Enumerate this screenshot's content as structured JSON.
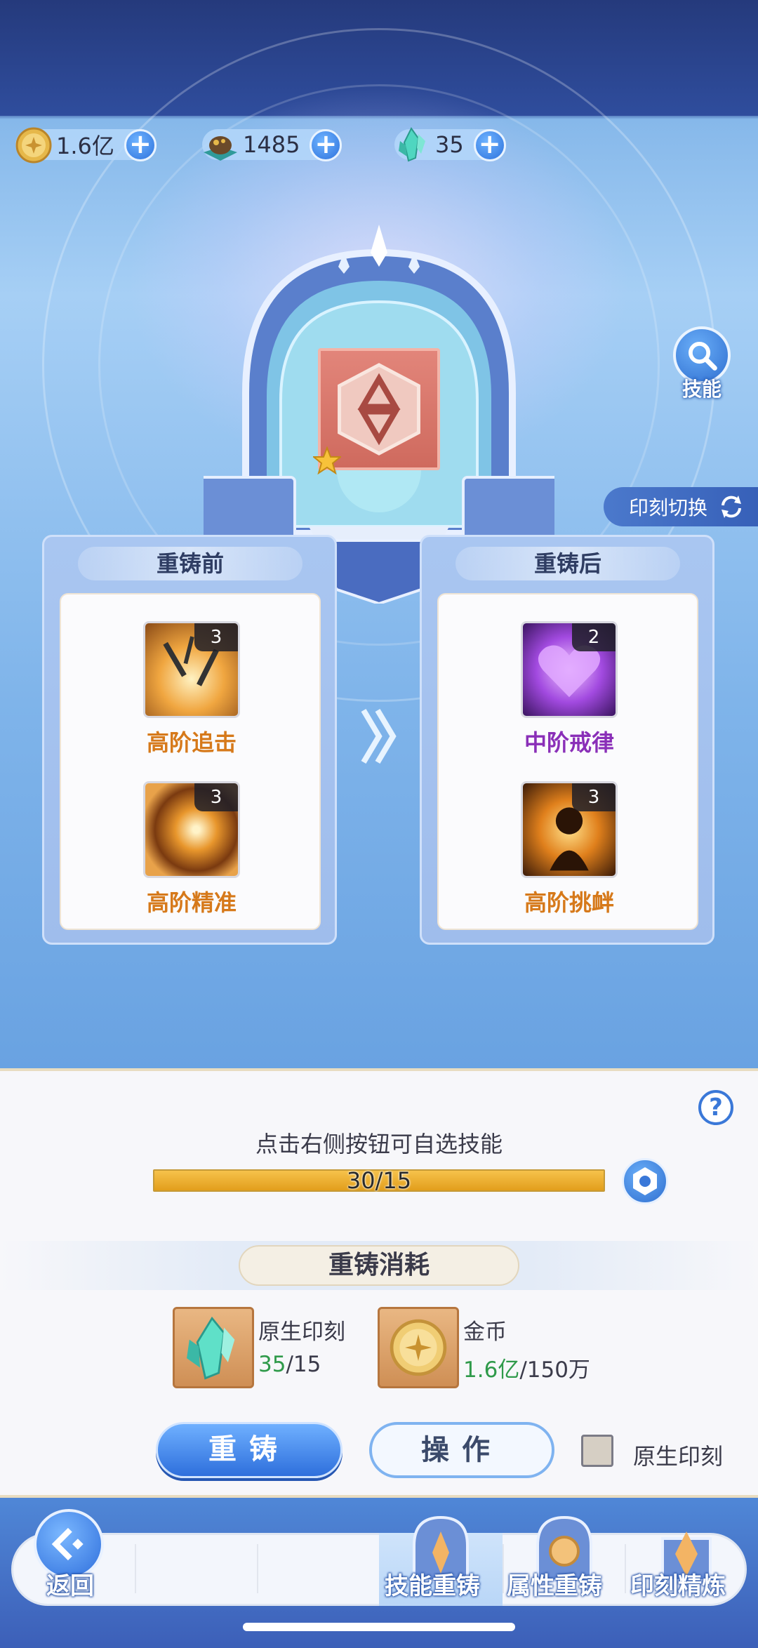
{
  "currencies": [
    {
      "icon": "gold-coin-icon",
      "value": "1.6亿"
    },
    {
      "icon": "ore-pile-icon",
      "value": "1485"
    },
    {
      "icon": "crystal-icon",
      "value": "35"
    }
  ],
  "side": {
    "skill_label": "技能",
    "switch_label": "印刻切换"
  },
  "before": {
    "title": "重铸前",
    "skills": [
      {
        "name": "高阶追击",
        "level": "3",
        "icon": "daggers-icon"
      },
      {
        "name": "高阶精准",
        "level": "3",
        "icon": "vortex-icon"
      }
    ]
  },
  "after": {
    "title": "重铸后",
    "skills": [
      {
        "name": "中阶戒律",
        "level": "2",
        "icon": "heart-icon"
      },
      {
        "name": "高阶挑衅",
        "level": "3",
        "icon": "taunt-figure-icon"
      }
    ]
  },
  "bottom": {
    "hint": "点击右侧按钮可自选技能",
    "progress": {
      "text": "30/15",
      "current": 30,
      "max": 15
    },
    "cost_title": "重铸消耗",
    "costs": [
      {
        "name": "原生印刻",
        "have": "35",
        "need": "/15",
        "icon": "crystal-icon"
      },
      {
        "name": "金币",
        "have": "1.6亿",
        "need": "/150万",
        "icon": "gold-coin-icon"
      }
    ],
    "reforge_label": "重铸",
    "operate_label": "操作",
    "checkbox_label": "原生印刻"
  },
  "nav": {
    "back": "返回",
    "tabs": [
      "技能重铸",
      "属性重铸",
      "印刻精炼"
    ],
    "active": 0
  },
  "colors": {
    "accent": "#2f6fdc",
    "skill_orange": "#d6791a",
    "skill_purple": "#8a2fb8",
    "have_green": "#2f9a4a"
  }
}
